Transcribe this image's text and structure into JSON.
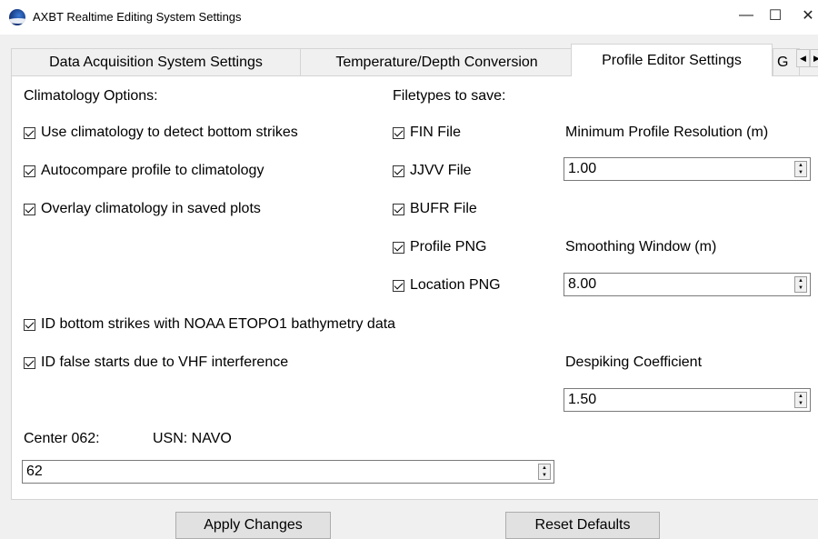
{
  "window": {
    "title": "AXBT Realtime Editing System Settings",
    "minimize_glyph": "—",
    "maximize_glyph": "☐",
    "close_glyph": "✕"
  },
  "tabs": [
    {
      "label": "Data Acquisition System Settings",
      "active": false
    },
    {
      "label": "Temperature/Depth Conversion",
      "active": false
    },
    {
      "label": "Profile Editor Settings",
      "active": true
    },
    {
      "label": "G",
      "active": false
    }
  ],
  "tab_scroll": {
    "left": "◀",
    "right": "▶"
  },
  "climatology": {
    "heading": "Climatology Options:",
    "options": [
      {
        "label": "Use climatology to detect bottom strikes",
        "checked": true
      },
      {
        "label": "Autocompare profile to climatology",
        "checked": true
      },
      {
        "label": "Overlay climatology in saved plots",
        "checked": true
      }
    ]
  },
  "filetypes": {
    "heading": "Filetypes to save:",
    "options": [
      {
        "label": "FIN File",
        "checked": true
      },
      {
        "label": "JJVV File",
        "checked": true
      },
      {
        "label": "BUFR File",
        "checked": true
      },
      {
        "label": "Profile PNG",
        "checked": true
      },
      {
        "label": "Location PNG",
        "checked": true
      }
    ]
  },
  "resolution": {
    "label": "Minimum Profile Resolution (m)",
    "value": "1.00"
  },
  "smoothing": {
    "label": "Smoothing Window (m)",
    "value": "8.00"
  },
  "bathymetry": {
    "label": "ID bottom strikes with NOAA ETOPO1 bathymetry data",
    "checked": true
  },
  "vhf": {
    "label": "ID false starts due to VHF interference",
    "checked": true
  },
  "despiking": {
    "label": "Despiking Coefficient",
    "value": "1.50"
  },
  "center": {
    "label": "Center 062:",
    "name": "USN: NAVO",
    "value": "62"
  },
  "buttons": {
    "apply": "Apply Changes",
    "reset": "Reset Defaults"
  },
  "spin_arrows": {
    "up": "▲",
    "down": "▼"
  }
}
